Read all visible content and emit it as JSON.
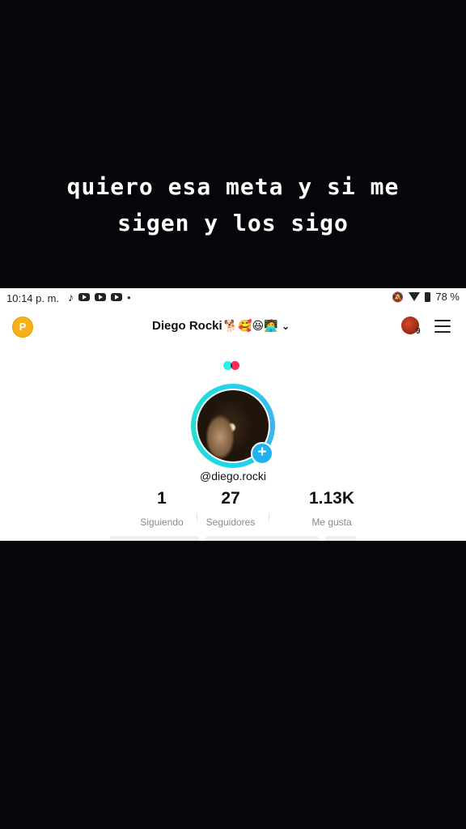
{
  "caption": {
    "line1": "quiero esa meta y si me",
    "line2": "sigen y los sigo"
  },
  "status_bar": {
    "time": "10:14 p. m.",
    "battery": "78 %",
    "icons": [
      "tiktok-icon",
      "youtube-icon",
      "youtube-icon",
      "youtube-icon",
      "notification-dot",
      "mute-icon",
      "wifi-icon",
      "battery-icon"
    ]
  },
  "profile": {
    "coin_label": "P",
    "display_name": "Diego Rocki",
    "name_emojis": "🐕🥰😆🧑‍💻",
    "friend_badge_count": "9",
    "handle": "@diego.rocki",
    "stats": [
      {
        "value": "1",
        "label": "Siguiendo"
      },
      {
        "value": "27",
        "label": "Seguidores"
      },
      {
        "value": "1.13K",
        "label": "Me gusta"
      }
    ]
  },
  "colors": {
    "background": "#06050a",
    "ring": "#20d5ec",
    "plus": "#20b3f0",
    "coin": "#f5b21c"
  }
}
